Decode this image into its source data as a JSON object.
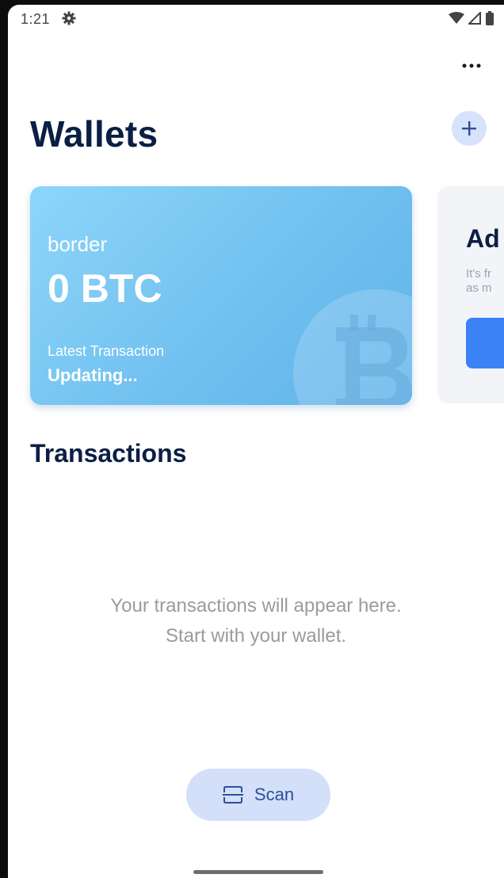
{
  "status_bar": {
    "time": "1:21",
    "icons": [
      "settings-gear-icon",
      "wifi-icon",
      "signal-icon",
      "battery-icon"
    ]
  },
  "header": {
    "title": "Wallets",
    "more_icon": "more-horizontal-icon",
    "add_icon": "plus-icon"
  },
  "wallets": [
    {
      "name": "border",
      "balance": "0 BTC",
      "latest_transaction_label": "Latest Transaction",
      "latest_transaction_value": "Updating...",
      "icon": "bitcoin-icon"
    }
  ],
  "add_wallet_card": {
    "title_partial": "Ad",
    "description_partial": "It's fr\nas m"
  },
  "transactions": {
    "title": "Transactions",
    "empty_line1": "Your transactions will appear here.",
    "empty_line2": "Start with your wallet."
  },
  "scan_button": {
    "label": "Scan",
    "icon": "scan-icon"
  },
  "colors": {
    "title": "#0b1f45",
    "card_gradient_start": "#8dd6fa",
    "card_gradient_end": "#5fb2ea",
    "accent_blue": "#3b82f6",
    "scan_bg": "#d4dffa"
  }
}
